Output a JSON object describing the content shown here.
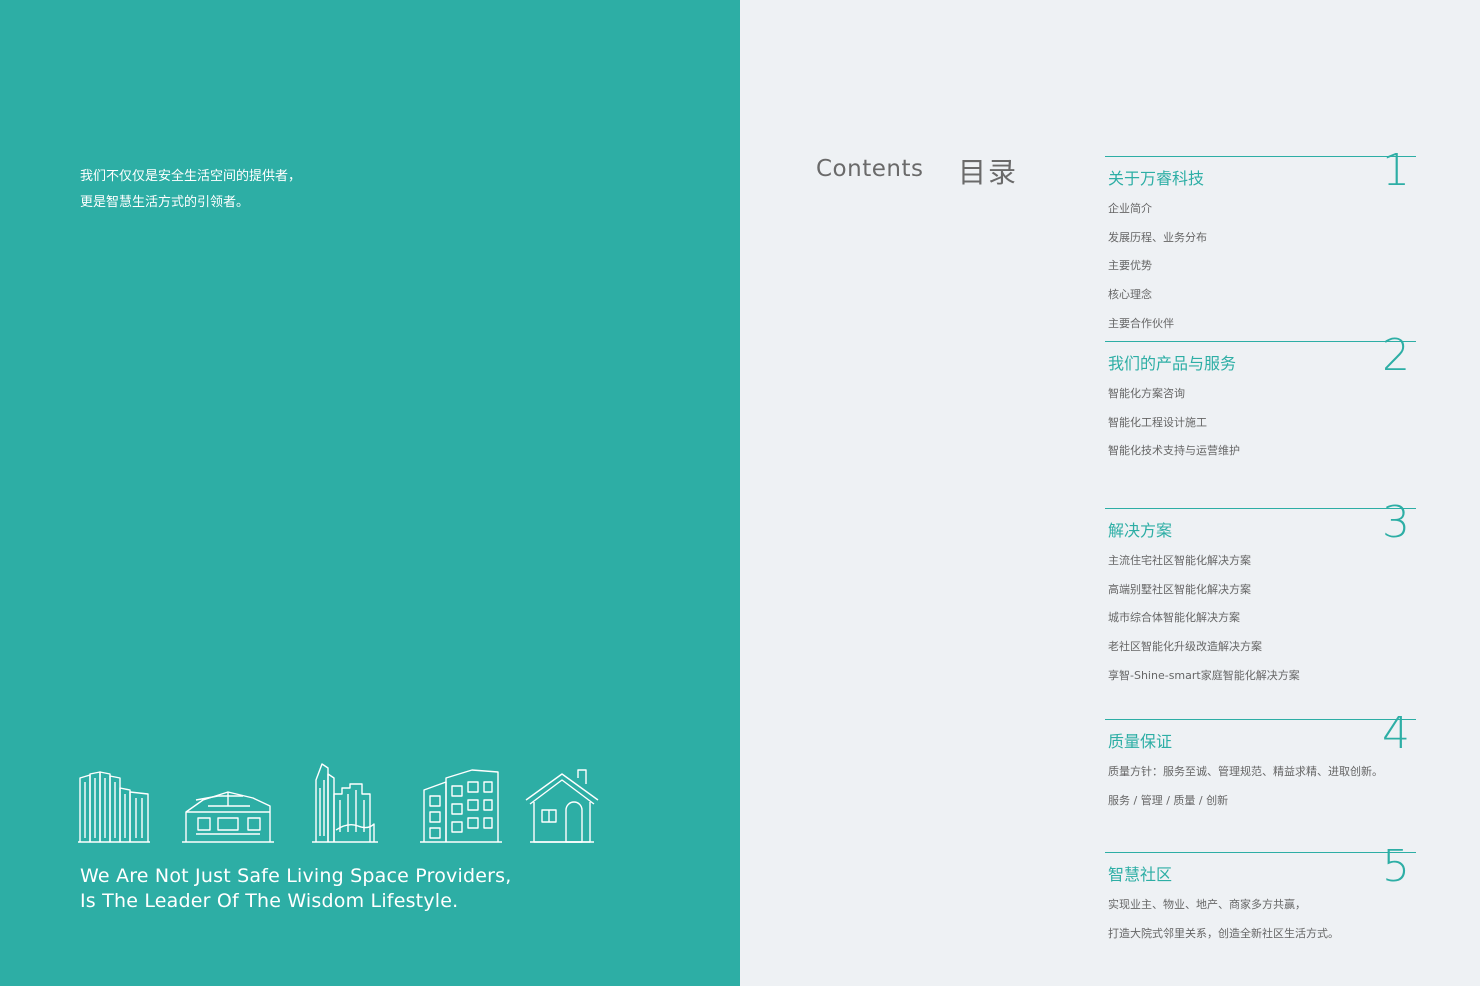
{
  "left": {
    "tagline": [
      "我们不仅仅是安全生活空间的提供者，",
      "更是智慧生活方式的引领者。"
    ],
    "slogan": [
      "We Are Not Just Safe Living Space Providers,",
      "Is The Leader Of The Wisdom Lifestyle."
    ],
    "colors": {
      "background": "#2daea5",
      "line": "#ffffff"
    },
    "icons": [
      "high-rise-icon",
      "villa-icon",
      "skyscraper-icon",
      "apartment-icon",
      "house-icon"
    ]
  },
  "right": {
    "heading_en": "Contents",
    "heading_zh": "目录",
    "colors": {
      "accent": "#2daea5",
      "text": "#666666",
      "background": "#eef1f4"
    },
    "sections": [
      {
        "number": "1",
        "title": "关于万睿科技",
        "items": [
          "企业简介",
          "发展历程、业务分布",
          "主要优势",
          "核心理念",
          "主要合作伙伴"
        ]
      },
      {
        "number": "2",
        "title": "我们的产品与服务",
        "items": [
          "智能化方案咨询",
          "智能化工程设计施工",
          "智能化技术支持与运营维护"
        ]
      },
      {
        "number": "3",
        "title": "解决方案",
        "items": [
          "主流住宅社区智能化解决方案",
          "高端别墅社区智能化解决方案",
          "城市综合体智能化解决方案",
          "老社区智能化升级改造解决方案",
          "享智-Shine-smart家庭智能化解决方案"
        ]
      },
      {
        "number": "4",
        "title": "质量保证",
        "items": [
          "质量方针：服务至诚、管理规范、精益求精、进取创新。",
          "服务 / 管理 / 质量 / 创新"
        ]
      },
      {
        "number": "5",
        "title": "智慧社区",
        "items": [
          "实现业主、物业、地产、商家多方共赢，",
          "打造大院式邻里关系，创造全新社区生活方式。"
        ]
      }
    ]
  }
}
